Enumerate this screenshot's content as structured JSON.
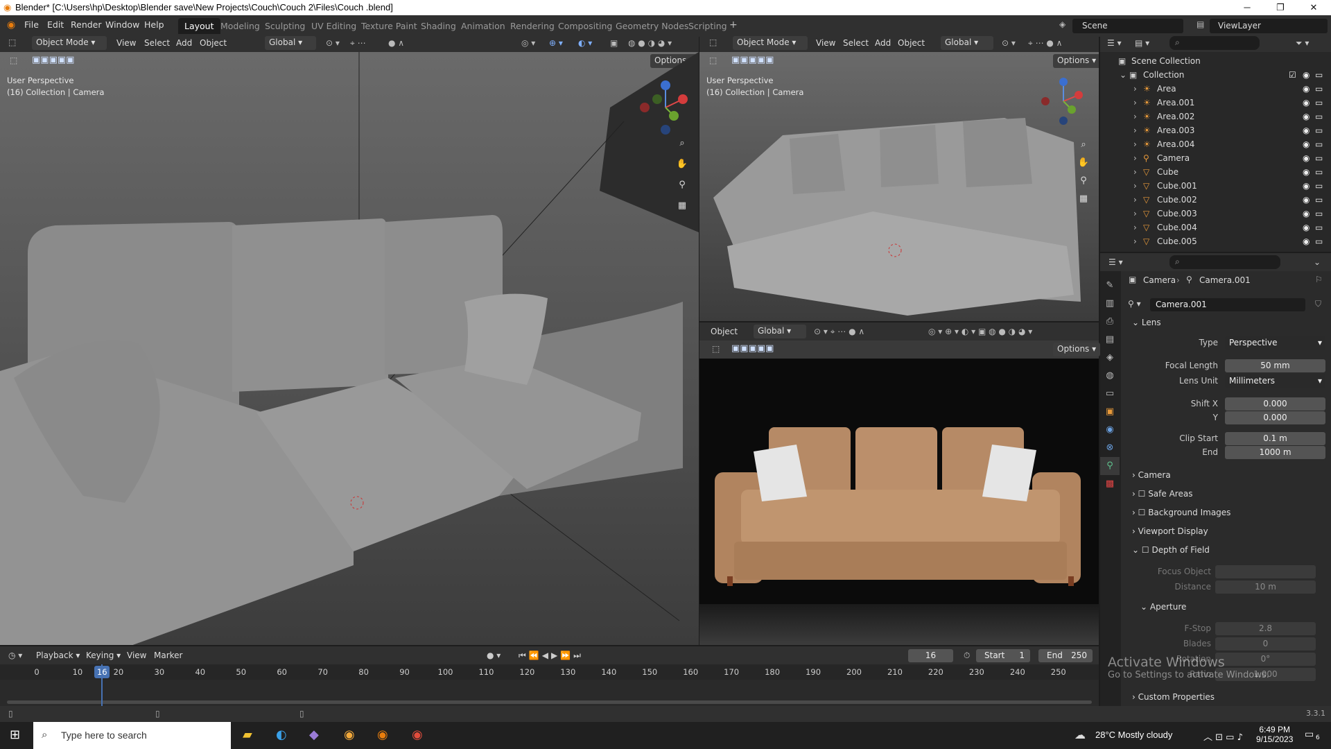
{
  "window": {
    "title": "Blender* [C:\\Users\\hp\\Desktop\\Blender save\\New Projects\\Couch\\Couch 2\\Files\\Couch .blend]",
    "minimize": "─",
    "maximize": "❐",
    "close": "✕"
  },
  "menu": [
    "File",
    "Edit",
    "Render",
    "Window",
    "Help"
  ],
  "workspaces": [
    "Layout",
    "Modeling",
    "Sculpting",
    "UV Editing",
    "Texture Paint",
    "Shading",
    "Animation",
    "Rendering",
    "Compositing",
    "Geometry Nodes",
    "Scripting"
  ],
  "active_workspace": "Layout",
  "scene": {
    "name": "Scene",
    "view_layer": "ViewLayer"
  },
  "viewport_left": {
    "mode": "Object Mode",
    "menus": [
      "View",
      "Select",
      "Add",
      "Object"
    ],
    "orientation": "Global",
    "options": "Options",
    "perspective": "User Perspective",
    "collection": "(16) Collection | Camera"
  },
  "viewport_right": {
    "mode": "Object Mode",
    "menus": [
      "View",
      "Select",
      "Add",
      "Object"
    ],
    "orientation": "Global",
    "options": "Options",
    "perspective": "User Perspective",
    "collection": "(16) Collection | Camera"
  },
  "render_view": {
    "menu": "Object",
    "orientation": "Global",
    "options": "Options"
  },
  "outliner": {
    "root": "Scene Collection",
    "collection": "Collection",
    "items": [
      "Area",
      "Area.001",
      "Area.002",
      "Area.003",
      "Area.004",
      "Camera",
      "Cube",
      "Cube.001",
      "Cube.002",
      "Cube.003",
      "Cube.004",
      "Cube.005"
    ]
  },
  "properties": {
    "breadcrumb": [
      "Camera",
      "Camera.001"
    ],
    "datablock": "Camera.001",
    "lens": {
      "title": "Lens",
      "type_label": "Type",
      "type": "Perspective",
      "focal_label": "Focal Length",
      "focal": "50 mm",
      "unit_label": "Lens Unit",
      "unit": "Millimeters",
      "shiftx_label": "Shift X",
      "shiftx": "0.000",
      "shifty_label": "Y",
      "shifty": "0.000",
      "clipstart_label": "Clip Start",
      "clipstart": "0.1 m",
      "clipend_label": "End",
      "clipend": "1000 m"
    },
    "panels": [
      "Camera",
      "Safe Areas",
      "Background Images",
      "Viewport Display",
      "Depth of Field"
    ],
    "dof": {
      "focus_label": "Focus Object",
      "distance_label": "Distance",
      "distance": "10 m",
      "aperture": "Aperture",
      "fstop_label": "F-Stop",
      "fstop": "2.8",
      "blades_label": "Blades",
      "blades": "0",
      "rotation_label": "Rotation",
      "rotation": "0°",
      "ratio_label": "Ratio",
      "ratio": "1.000"
    },
    "custom": "Custom Properties"
  },
  "timeline": {
    "menus": [
      "Playback",
      "Keying",
      "View",
      "Marker"
    ],
    "current": "16",
    "start_label": "Start",
    "start": "1",
    "end_label": "End",
    "end": "250",
    "ticks": [
      "0",
      "10",
      "20",
      "30",
      "40",
      "50",
      "60",
      "70",
      "80",
      "90",
      "100",
      "110",
      "120",
      "130",
      "140",
      "150",
      "160",
      "170",
      "180",
      "190",
      "200",
      "210",
      "220",
      "230",
      "240",
      "250"
    ],
    "frame": 16
  },
  "status": {
    "version": "3.3.1"
  },
  "watermark": {
    "line1": "Activate Windows",
    "line2": "Go to Settings to activate Windows."
  },
  "taskbar": {
    "search": "Type here to search",
    "weather": "28°C  Mostly cloudy",
    "time": "6:49 PM",
    "date": "9/15/2023",
    "notif": "6"
  },
  "colors": {
    "accent": "#4772b3",
    "orange": "#e87d0d"
  }
}
